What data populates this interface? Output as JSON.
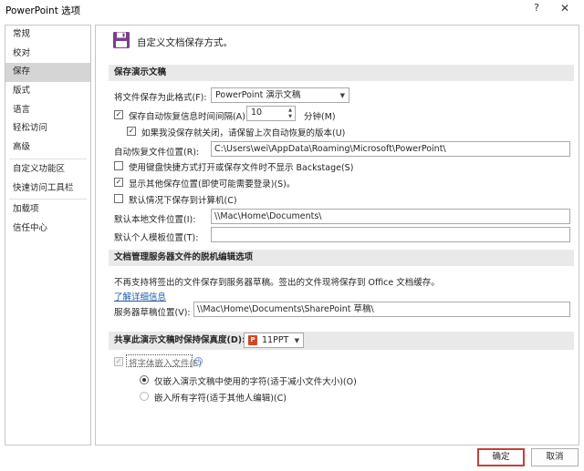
{
  "window": {
    "title": "PowerPoint 选项",
    "help": "?",
    "close": "✕"
  },
  "sidebar": {
    "items": [
      {
        "label": "常规"
      },
      {
        "label": "校对"
      },
      {
        "label": "保存"
      },
      {
        "label": "版式"
      },
      {
        "label": "语言"
      },
      {
        "label": "轻松访问"
      },
      {
        "label": "高级"
      },
      {
        "label": "自定义功能区"
      },
      {
        "label": "快速访问工具栏"
      },
      {
        "label": "加载项"
      },
      {
        "label": "信任中心"
      }
    ],
    "selected": "保存"
  },
  "header": {
    "title": "自定义文档保存方式。",
    "icon": "floppy-disk-icon"
  },
  "save_presentations": {
    "heading": "保存演示文稿",
    "format_label": "将文件保存为此格式(F):",
    "format_value": "PowerPoint 演示文稿",
    "autorecover_label": "保存自动恢复信息时间间隔(A)",
    "autorecover_checked": true,
    "autorecover_minutes": "10",
    "minutes_label": "分钟(M)",
    "keep_last_label": "如果我没保存就关闭，请保留上次自动恢复的版本(U)",
    "keep_last_checked": true,
    "autorecover_location_label": "自动恢复文件位置(R):",
    "autorecover_location_value": "C:\\Users\\wei\\AppData\\Roaming\\Microsoft\\PowerPoint\\",
    "no_backstage_label": "使用键盘快捷方式打开或保存文件时不显示 Backstage(S)",
    "no_backstage_checked": false,
    "show_additional_label": "显示其他保存位置(即使可能需要登录)(S)。",
    "show_additional_checked": true,
    "save_to_computer_label": "默认情况下保存到计算机(C)",
    "save_to_computer_checked": false,
    "local_location_label": "默认本地文件位置(I):",
    "local_location_value": "\\\\Mac\\Home\\Documents\\",
    "template_location_label": "默认个人模板位置(T):",
    "template_location_value": ""
  },
  "offline_editing": {
    "heading": "文档管理服务器文件的脱机编辑选项",
    "note": "不再支持将签出的文件保存到服务器草稿。签出的文件现将保存到 Office 文档缓存。",
    "learn_more": "了解详细信息",
    "drafts_label": "服务器草稿位置(V):",
    "drafts_value": "\\\\Mac\\Home\\Documents\\SharePoint 草稿\\"
  },
  "fidelity": {
    "heading": "共享此演示文稿时保持保真度(D):",
    "file_value": "11PPT",
    "file_icon_text": "P",
    "embed_fonts_label": "将字体嵌入文件(E)",
    "embed_fonts_checked": true,
    "info_icon": "i",
    "embed_used_label": "仅嵌入演示文稿中使用的字符(适于减小文件大小)(O)",
    "embed_used_checked": true,
    "embed_all_label": "嵌入所有字符(适于其他人编辑)(C)",
    "embed_all_checked": false
  },
  "buttons": {
    "ok": "确定",
    "cancel": "取消"
  },
  "glyphs": {
    "check": "✓",
    "dropdown": "▼",
    "spin_up": "▲",
    "spin_down": "▼"
  },
  "colors": {
    "selected_nav": "#d5d5d5",
    "section_header": "#e9e9e9",
    "link": "#1f5aa6",
    "primary_border": "#c4403a",
    "ppt_icon": "#d24726",
    "floppy_icon": "#7c3f8c"
  }
}
